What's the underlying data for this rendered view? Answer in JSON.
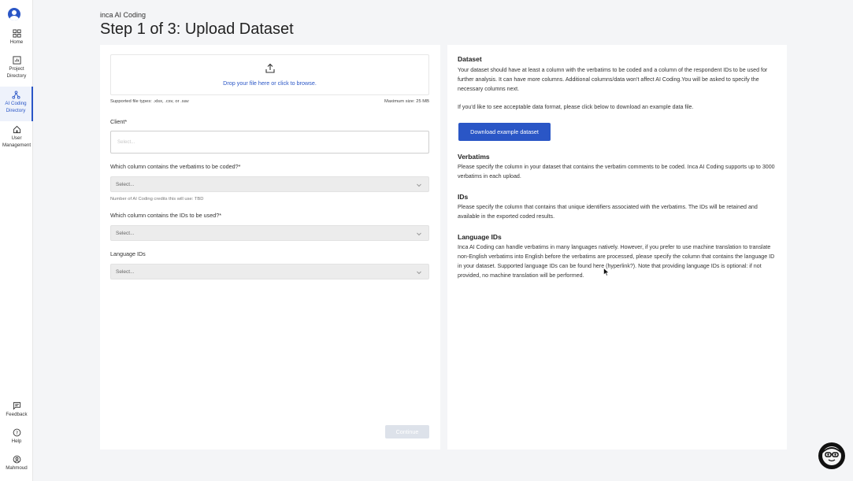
{
  "sidebar": {
    "items": [
      {
        "label": "Home",
        "icon": "grid-icon"
      },
      {
        "label": "Project Directory",
        "icon": "chart-icon"
      },
      {
        "label": "AI Coding Directory",
        "icon": "network-icon",
        "active": true
      },
      {
        "label": "User Management",
        "icon": "house-icon"
      }
    ],
    "bottom": [
      {
        "label": "Feedback",
        "icon": "feedback-icon"
      },
      {
        "label": "Help",
        "icon": "help-icon"
      },
      {
        "label": "Mahmoud",
        "icon": "user-icon"
      }
    ]
  },
  "header": {
    "app_name": "inca AI Coding",
    "title": "Step 1 of 3: Upload Dataset"
  },
  "upload": {
    "drop_text": "Drop your file here or click to browse.",
    "supported": "Supported file types: .xlsx, .csv, or .sav",
    "max_size": "Maximum size: 25 MB"
  },
  "form": {
    "client_label": "Client",
    "client_placeholder": "Select...",
    "verbatims_label": "Which column contains the verbatims to be coded?",
    "verbatims_placeholder": "Select...",
    "credits_note": "Number of AI Coding credits this will use: TBD",
    "ids_label": "Which column contains the IDs to be used?",
    "ids_placeholder": "Select...",
    "lang_label": "Language IDs",
    "lang_placeholder": "Select...",
    "required_mark": "*",
    "continue_label": "Continue"
  },
  "info": {
    "dataset_title": "Dataset",
    "dataset_text": "Your dataset should have at least a column with the verbatims to be coded and a column of the respondent IDs to be used for further analysis. It can have more columns. Additional columns/data won't affect AI Coding.You will be asked to specify the necessary columns next.",
    "dataset_text2": "If you'd like to see acceptable data format, please click below to download an example data file.",
    "download_label": "Download example dataset",
    "verbatims_title": "Verbatims",
    "verbatims_text": "Please specify the column in your dataset that contains the verbatim comments to be coded. Inca AI Coding supports up to 3000 verbatims in each upload.",
    "ids_title": "IDs",
    "ids_text": "Please specify the column that contains that unique identifiers associated with the verbatims. The IDs will be retained and available in the exported coded results.",
    "lang_title": "Language IDs",
    "lang_text": "Inca AI Coding can handle verbatims in many languages natively. However, if you prefer to use machine translation to translate non-English verbatims into English before the verbatims are processed, please specify the column that contains the language ID in your dataset. Supported language IDs can be found here (hyperlink?). Note that providing language IDs is optional: if not provided, no machine translation will be performed."
  },
  "colors": {
    "accent": "#2a56c6",
    "background": "#f4f5f7",
    "disabled_button": "#dde2ea"
  }
}
